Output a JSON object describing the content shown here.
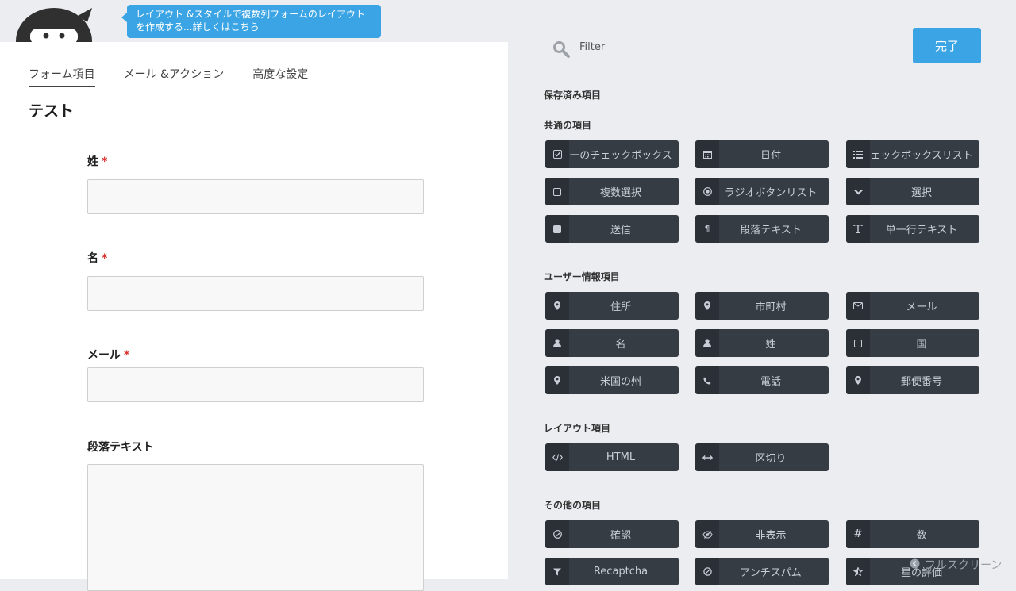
{
  "tooltip": {
    "line1": "レイアウト &スタイルで複数列フォームのレイアウト",
    "line2": "を作成する...詳しくはこちら"
  },
  "tabs": [
    {
      "label": "フォーム項目",
      "active": true
    },
    {
      "label": "メール &アクション",
      "active": false
    },
    {
      "label": "高度な設定",
      "active": false
    }
  ],
  "form": {
    "title": "テスト",
    "required_marker": "*",
    "fields": [
      {
        "label": "姓",
        "required": true,
        "type": "textbox"
      },
      {
        "label": "名",
        "required": true,
        "type": "textbox"
      },
      {
        "label": "メール",
        "required": true,
        "type": "textbox"
      },
      {
        "label": "段落テキスト",
        "required": false,
        "type": "textarea"
      }
    ]
  },
  "drawer": {
    "filter_placeholder": "Filter",
    "done_label": "完了",
    "saved_title": "保存済み項目",
    "sections": [
      {
        "title": "共通の項目",
        "items": [
          {
            "label": "ーのチェックボックス",
            "icon": "checkbox-checked-icon"
          },
          {
            "label": "日付",
            "icon": "calendar-icon"
          },
          {
            "label": "ェックボックスリスト",
            "icon": "list-icon"
          },
          {
            "label": "複数選択",
            "icon": "square-icon"
          },
          {
            "label": "ラジオボタンリスト",
            "icon": "radio-icon"
          },
          {
            "label": "選択",
            "icon": "chevron-down-icon"
          },
          {
            "label": "送信",
            "icon": "filled-square-icon"
          },
          {
            "label": "段落テキスト",
            "icon": "pilcrow-icon"
          },
          {
            "label": "単一行テキスト",
            "icon": "text-icon"
          }
        ]
      },
      {
        "title": "ユーザー情報項目",
        "items": [
          {
            "label": "住所",
            "icon": "map-marker-icon"
          },
          {
            "label": "市町村",
            "icon": "map-marker-icon"
          },
          {
            "label": "メール",
            "icon": "envelope-icon"
          },
          {
            "label": "名",
            "icon": "user-icon"
          },
          {
            "label": "姓",
            "icon": "user-icon"
          },
          {
            "label": "国",
            "icon": "square-icon"
          },
          {
            "label": "米国の州",
            "icon": "map-marker-icon"
          },
          {
            "label": "電話",
            "icon": "phone-icon"
          },
          {
            "label": "郵便番号",
            "icon": "map-marker-icon"
          }
        ]
      },
      {
        "title": "レイアウト項目",
        "items": [
          {
            "label": "HTML",
            "icon": "code-icon"
          },
          {
            "label": "区切り",
            "icon": "arrows-h-icon"
          }
        ]
      },
      {
        "title": "その他の項目",
        "items": [
          {
            "label": "確認",
            "icon": "check-circle-icon"
          },
          {
            "label": "非表示",
            "icon": "eye-slash-icon"
          },
          {
            "label": "数",
            "icon": "hash-icon"
          },
          {
            "label": "Recaptcha",
            "icon": "filter-icon"
          },
          {
            "label": "アンチスパム",
            "icon": "ban-icon"
          },
          {
            "label": "星の評価",
            "icon": "star-half-icon"
          }
        ]
      }
    ],
    "fullscreen_label": "フルスクリーン"
  },
  "colors": {
    "accent": "#3ba4e4",
    "drawer_bg": "#ebedf0",
    "button_bg": "#363c44",
    "required": "#d9312d"
  }
}
